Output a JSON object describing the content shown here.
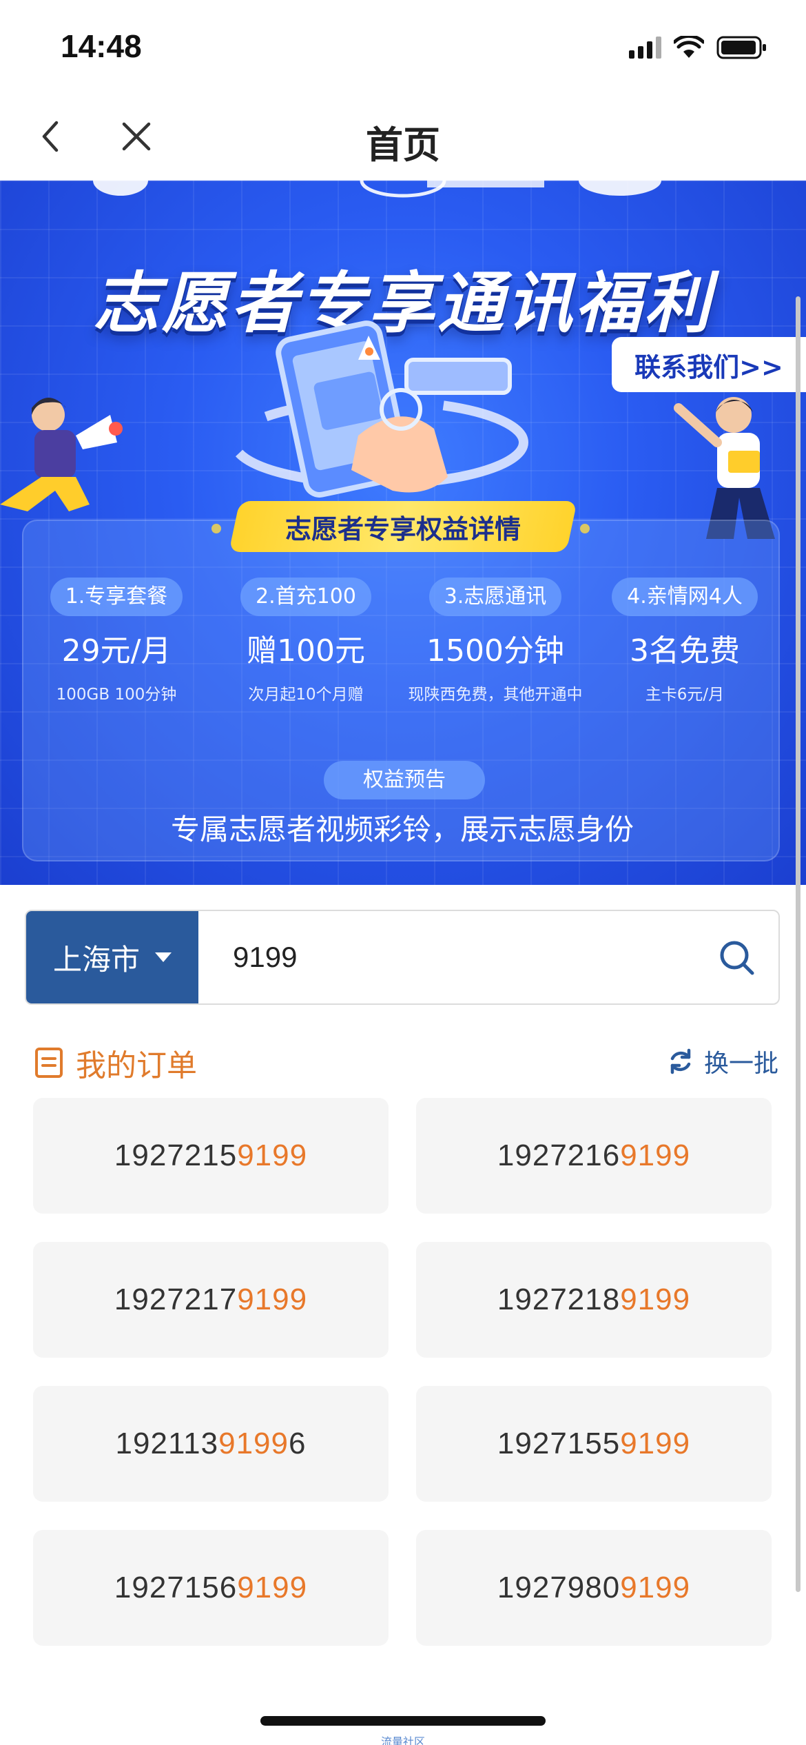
{
  "status_bar": {
    "time": "14:48",
    "battery_level": 0.9
  },
  "nav": {
    "title": "首页"
  },
  "banner": {
    "title": "志愿者专享通讯福利",
    "contact_label": "联系我们>>",
    "benefit_heading": "志愿者专享权益详情",
    "benefits": [
      {
        "tag": "1.专享套餐",
        "value": "29元/月",
        "sub": "100GB  100分钟"
      },
      {
        "tag": "2.首充100",
        "value": "赠100元",
        "sub": "次月起10个月赠"
      },
      {
        "tag": "3.志愿通讯",
        "value": "1500分钟",
        "sub": "现陕西免费，其他开通中"
      },
      {
        "tag": "4.亲情网4人",
        "value": "3名免费",
        "sub": "主卡6元/月"
      }
    ],
    "preview_tag": "权益预告",
    "preview_text": "专属志愿者视频彩铃，展示志愿身份"
  },
  "search": {
    "city": "上海市",
    "query": "9199"
  },
  "orders": {
    "title": "我的订单",
    "refresh_label": "换一批",
    "numbers": [
      {
        "prefix": "1927215",
        "highlight": "9199",
        "suffix": ""
      },
      {
        "prefix": "1927216",
        "highlight": "9199",
        "suffix": ""
      },
      {
        "prefix": "1927217",
        "highlight": "9199",
        "suffix": ""
      },
      {
        "prefix": "1927218",
        "highlight": "9199",
        "suffix": ""
      },
      {
        "prefix": "192113",
        "highlight": "9199",
        "suffix": "6"
      },
      {
        "prefix": "1927155",
        "highlight": "9199",
        "suffix": ""
      },
      {
        "prefix": "1927156",
        "highlight": "9199",
        "suffix": ""
      },
      {
        "prefix": "1927980",
        "highlight": "9199",
        "suffix": ""
      }
    ]
  },
  "footer": {
    "text": "流量社区"
  },
  "colors": {
    "accent_orange": "#e8782a",
    "city_blue": "#2a5a9c",
    "banner_blue": "#2a5cf2",
    "pill_yellow": "#ffd32c"
  }
}
